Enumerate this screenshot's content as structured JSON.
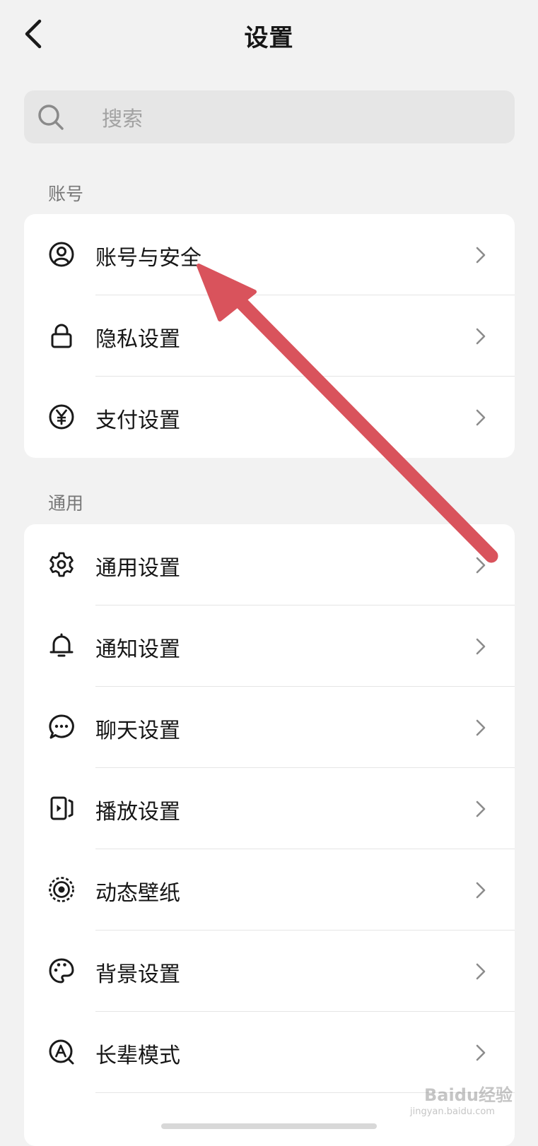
{
  "header": {
    "title": "设置",
    "back_icon": "chevron-left-icon"
  },
  "search": {
    "placeholder": "搜索",
    "icon": "search-icon"
  },
  "sections": [
    {
      "label": "账号",
      "items": [
        {
          "label": "账号与安全",
          "icon": "user-circle-icon"
        },
        {
          "label": "隐私设置",
          "icon": "lock-icon"
        },
        {
          "label": "支付设置",
          "icon": "yen-icon"
        }
      ]
    },
    {
      "label": "通用",
      "items": [
        {
          "label": "通用设置",
          "icon": "gear-icon"
        },
        {
          "label": "通知设置",
          "icon": "bell-icon"
        },
        {
          "label": "聊天设置",
          "icon": "chat-bubble-icon"
        },
        {
          "label": "播放设置",
          "icon": "play-screen-icon"
        },
        {
          "label": "动态壁纸",
          "icon": "live-wallpaper-icon"
        },
        {
          "label": "背景设置",
          "icon": "palette-icon"
        },
        {
          "label": "长辈模式",
          "icon": "elder-mode-icon"
        }
      ]
    }
  ],
  "annotation": {
    "color": "#d9535c"
  },
  "watermark": {
    "brand": "Baidu经验",
    "url": "jingyan.baidu.com"
  }
}
